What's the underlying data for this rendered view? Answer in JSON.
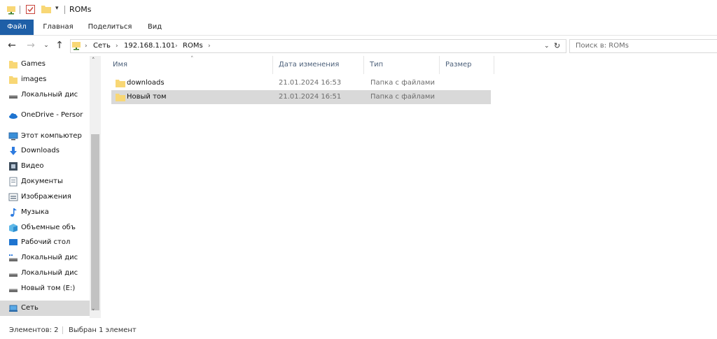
{
  "window": {
    "title": "ROMs"
  },
  "ribbon": {
    "tabs": [
      "Файл",
      "Главная",
      "Поделиться",
      "Вид"
    ]
  },
  "address": {
    "crumbs": [
      "Сеть",
      "192.168.1.101",
      "ROMs"
    ]
  },
  "search": {
    "placeholder": "Поиск в: ROMs"
  },
  "sidebar": {
    "items": [
      {
        "label": "Games",
        "icon": "folder-icon"
      },
      {
        "label": "images",
        "icon": "folder-icon"
      },
      {
        "label": "Локальный дис",
        "icon": "drive-icon"
      },
      {
        "label": "OneDrive - Persor",
        "icon": "cloud-icon"
      },
      {
        "label": "Этот компьютер",
        "icon": "computer-icon"
      },
      {
        "label": "Downloads",
        "icon": "download-icon"
      },
      {
        "label": "Видео",
        "icon": "video-icon"
      },
      {
        "label": "Документы",
        "icon": "document-icon"
      },
      {
        "label": "Изображения",
        "icon": "picture-icon"
      },
      {
        "label": "Музыка",
        "icon": "music-icon"
      },
      {
        "label": "Объемные объ",
        "icon": "cube-icon"
      },
      {
        "label": "Рабочий стол",
        "icon": "desktop-icon"
      },
      {
        "label": "Локальный дис",
        "icon": "system-drive-icon"
      },
      {
        "label": "Локальный дис",
        "icon": "drive-icon"
      },
      {
        "label": "Новый том (E:)",
        "icon": "drive-icon"
      },
      {
        "label": "Сеть",
        "icon": "network-icon",
        "selected": true
      }
    ]
  },
  "columns": {
    "name": "Имя",
    "date": "Дата изменения",
    "type": "Тип",
    "size": "Размер"
  },
  "files": [
    {
      "name": "downloads",
      "date": "21.01.2024 16:53",
      "type": "Папка с файлами",
      "size": "",
      "selected": false
    },
    {
      "name": "Новый том",
      "date": "21.01.2024 16:51",
      "type": "Папка с файлами",
      "size": "",
      "selected": true
    }
  ],
  "status": {
    "count": "Элементов: 2",
    "selection": "Выбран 1 элемент"
  },
  "colors": {
    "accent": "#1e5fa7",
    "folder": "#f8d775",
    "selection": "#d9d9d9"
  }
}
